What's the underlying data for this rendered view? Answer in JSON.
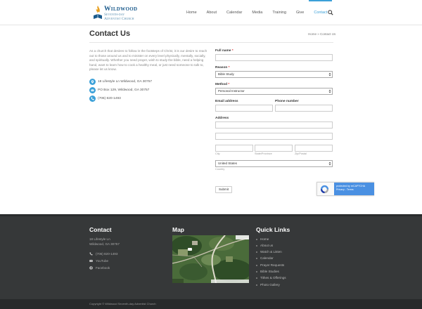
{
  "site": {
    "logo_title": "Wildwood",
    "logo_sub_1": "Seventh-day",
    "logo_sub_2": "Adventist Church"
  },
  "nav": {
    "items": [
      {
        "label": "Home"
      },
      {
        "label": "About"
      },
      {
        "label": "Calendar"
      },
      {
        "label": "Media"
      },
      {
        "label": "Training"
      },
      {
        "label": "Give"
      },
      {
        "label": "Contact"
      }
    ],
    "active": "Contact"
  },
  "page": {
    "title": "Contact Us",
    "breadcrumb": "Home » Contact Us"
  },
  "intro": "As a church that desires to follow in the footsteps of Christ, it is our desire to reach out to those around us and to minister on every level physically, mentally, socially, and spiritually. Whether you need prayer, wish to study the bible, need a helping hand, want to learn how to cook a healthy meal, or just need someone to talk to, please let us know.",
  "contact": {
    "address": "18 Lifestyle Ln Wildwood, GA 30757",
    "po_box": "PO Box 129, Wildwood, GA 30757",
    "phone": "(706) 820-1493"
  },
  "form": {
    "full_name_label": "Full name",
    "required_mark": "*",
    "reason_label": "Reason",
    "reason_value": "Bible Study",
    "method_label": "Method",
    "method_value": "Personal Instructor",
    "email_label": "Email address",
    "phone_label": "Phone number",
    "address_label": "Address",
    "city_label": "City",
    "state_label": "State/Province",
    "zip_label": "Zip/Postal",
    "country_value": "United States",
    "country_label": "Country",
    "submit_label": "Submit"
  },
  "recaptcha": {
    "line1": "protected by reCAPTCHA",
    "line2": "Privacy - Terms"
  },
  "footer": {
    "contact_title": "Contact",
    "address_1": "18 Lifestyle Ln",
    "address_2": "Wildwood, GA 30757",
    "phone": "(706) 820-1493",
    "youtube": "YouTube",
    "facebook": "Facebook",
    "map_title": "Map",
    "quick_links_title": "Quick Links",
    "quick_links": [
      {
        "label": "Home"
      },
      {
        "label": "About us"
      },
      {
        "label": "Watch & Listen"
      },
      {
        "label": "Calendar"
      },
      {
        "label": "Prayer Requests"
      },
      {
        "label": "Bible Studies"
      },
      {
        "label": "Tithes & Offerings"
      },
      {
        "label": "Photo Gallery"
      }
    ],
    "copyright": "Copyright © Wildwood Seventh-day Adventist Church"
  },
  "colors": {
    "accent": "#3ba0d8",
    "footer_bg": "#363839"
  }
}
